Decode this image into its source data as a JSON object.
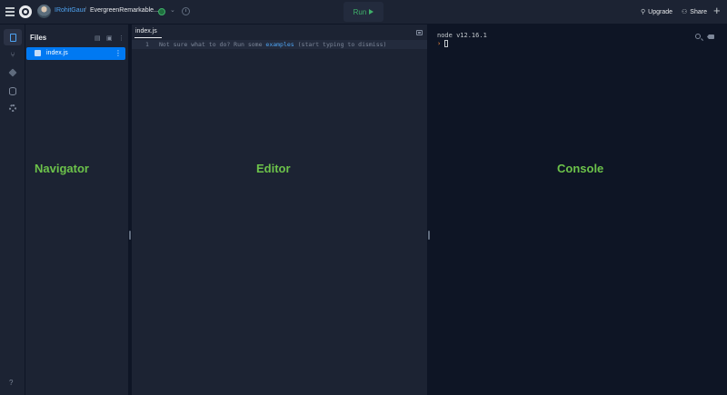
{
  "header": {
    "username": "IRohitGaur",
    "separator": "/",
    "repl_name": "EvergreenRemarkable...",
    "run_label": "Run",
    "upgrade_label": "Upgrade",
    "share_label": "Share",
    "add_label": "+"
  },
  "rail": {
    "help_label": "?"
  },
  "files": {
    "title": "Files",
    "items": [
      {
        "name": "index.js",
        "menu": "⋮"
      }
    ],
    "panel_label": "Navigator"
  },
  "editor": {
    "tab": "index.js",
    "line_number": "1",
    "hint_before": "Not sure what to do? Run some ",
    "hint_link": "examples",
    "hint_after": " (start typing to dismiss)",
    "panel_label": "Editor"
  },
  "console": {
    "node_version": "node v12.16.1",
    "prompt": "›",
    "panel_label": "Console"
  },
  "colors": {
    "accent_blue": "#0079f2",
    "run_green": "#3fb06a",
    "annotation_green": "#6cc24a",
    "prompt_orange": "#ff8f3f"
  },
  "icons": [
    "hamburger-icon",
    "replit-logo-icon",
    "avatar",
    "status-icon",
    "chevron-down-icon",
    "history-icon",
    "play-icon",
    "upgrade-icon",
    "share-icon",
    "plus-icon",
    "files-icon",
    "version-control-icon",
    "packages-icon",
    "database-icon",
    "settings-icon",
    "help-icon",
    "new-file-icon",
    "new-folder-icon",
    "more-icon",
    "layout-icon",
    "search-icon",
    "clear-console-icon"
  ]
}
